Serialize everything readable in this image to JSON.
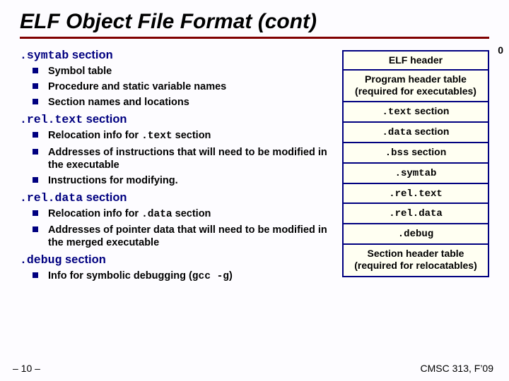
{
  "title": "ELF Object File Format (cont)",
  "zero_label": "0",
  "sections": [
    {
      "head_mono": ".symtab",
      "head_rest": " section",
      "bullets": [
        {
          "text": "Symbol table"
        },
        {
          "text": "Procedure and static variable names"
        },
        {
          "text": "Section names and locations"
        }
      ]
    },
    {
      "head_mono": ".rel.text",
      "head_rest": " section",
      "bullets": [
        {
          "pre": "Relocation info for ",
          "mono": ".text",
          "post": " section"
        },
        {
          "text": "Addresses of instructions that will need to be modified in the executable"
        },
        {
          "text": "Instructions for modifying."
        }
      ]
    },
    {
      "head_mono": ".rel.data",
      "head_rest": " section",
      "bullets": [
        {
          "pre": "Relocation info for ",
          "mono": ".data",
          "post": " section"
        },
        {
          "text": "Addresses of pointer data that will need to be modified in the merged executable"
        }
      ]
    },
    {
      "head_mono": ".debug",
      "head_rest": " section",
      "bullets": [
        {
          "pre": "Info for symbolic debugging (",
          "mono": "gcc -g",
          "post": ")"
        }
      ]
    }
  ],
  "table": [
    {
      "text": "ELF header"
    },
    {
      "line1": "Program header table",
      "line2": "(required for executables)"
    },
    {
      "mono": ".text",
      "post": " section"
    },
    {
      "mono": ".data",
      "post": " section"
    },
    {
      "mono": ".bss",
      "post": " section"
    },
    {
      "mono": ".symtab"
    },
    {
      "mono": ".rel.text"
    },
    {
      "mono": ".rel.data"
    },
    {
      "mono": ".debug"
    },
    {
      "line1": "Section header table",
      "line2": "(required for relocatables)"
    }
  ],
  "footer": {
    "left": "– 10 –",
    "right": "CMSC 313, F’09"
  }
}
